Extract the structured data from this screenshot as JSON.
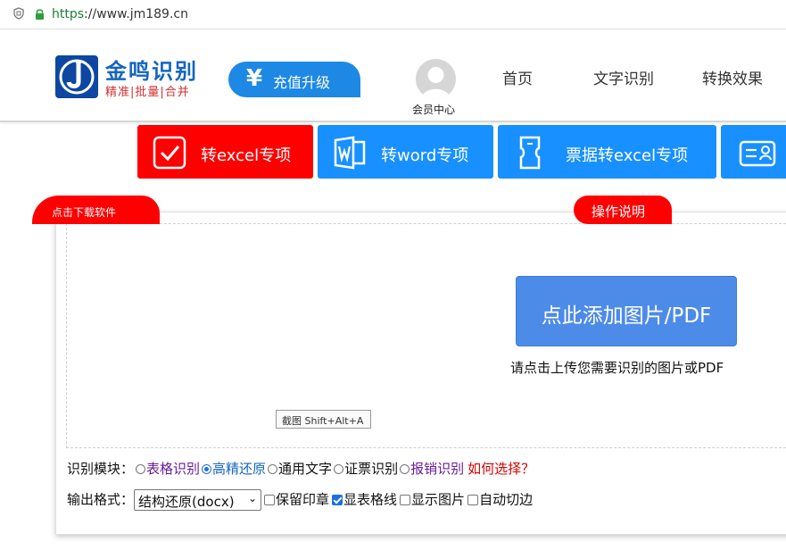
{
  "browser": {
    "url_scheme": "https",
    "url_rest": "://www.jm189.cn"
  },
  "header": {
    "logo_title": "金鸣识别",
    "logo_sub": "精准|批量|合并",
    "recharge_symbol": "¥",
    "recharge_label": "充值升级",
    "member_label": "会员中心",
    "nav": [
      "首页",
      "文字识别",
      "转换效果"
    ]
  },
  "tiles": [
    {
      "label": "转excel专项",
      "color": "#ff0000",
      "icon": "check-icon"
    },
    {
      "label": "转word专项",
      "color": "#1890ff",
      "icon": "word-icon"
    },
    {
      "label": "票据转excel专项",
      "color": "#1890ff",
      "icon": "ticket-icon"
    },
    {
      "label": "",
      "color": "#1890ff",
      "icon": "id-card-icon"
    }
  ],
  "upload": {
    "download_tab": "点击下载软件",
    "help_button": "操作说明",
    "add_button": "点此添加图片/PDF",
    "hint": "请点击上传您需要识别的图片或PDF",
    "shortcut": "截图 Shift+Alt+A"
  },
  "options": {
    "module_label": "识别模块：",
    "modules": [
      {
        "label": "表格识别",
        "selected": false
      },
      {
        "label": "高精还原",
        "selected": true
      },
      {
        "label": "通用文字",
        "selected": false
      },
      {
        "label": "证票识别",
        "selected": false
      },
      {
        "label": "报销识别",
        "selected": false
      }
    ],
    "how_to_choose": "如何选择？",
    "format_label": "输出格式：",
    "format_value": "结构还原(docx)",
    "checkboxes": [
      {
        "label": "保留印章",
        "checked": false
      },
      {
        "label": "显表格线",
        "checked": true
      },
      {
        "label": "显示图片",
        "checked": false
      },
      {
        "label": "自动切边",
        "checked": false
      }
    ]
  },
  "colors": {
    "brand_blue": "#1890ff",
    "accent_red": "#ff0000",
    "add_button": "#4d8be8"
  }
}
